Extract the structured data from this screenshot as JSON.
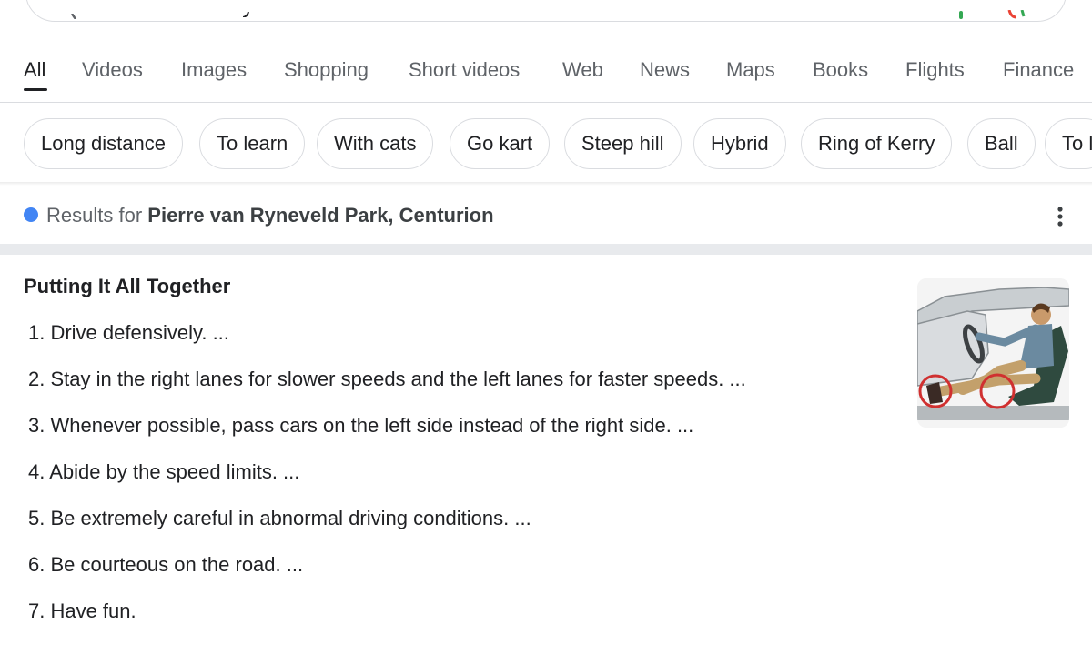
{
  "search": {
    "icon": "search-icon",
    "mic_icon": "mic-icon",
    "lens_icon": "lens-icon"
  },
  "tabs": [
    {
      "label": "All",
      "active": true
    },
    {
      "label": "Videos"
    },
    {
      "label": "Images"
    },
    {
      "label": "Shopping"
    },
    {
      "label": "Short videos"
    },
    {
      "label": "Web"
    },
    {
      "label": "News"
    },
    {
      "label": "Maps"
    },
    {
      "label": "Books"
    },
    {
      "label": "Flights"
    },
    {
      "label": "Finance"
    }
  ],
  "chips": [
    "Long distance",
    "To learn",
    "With cats",
    "Go kart",
    "Steep hill",
    "Hybrid",
    "Ring of Kerry",
    "Ball",
    "To l"
  ],
  "location": {
    "prefix": "Results for",
    "place": "Pierre van Ryneveld Park, Centurion",
    "dot_color": "#4285f4"
  },
  "snippet": {
    "title": "Putting It All Together",
    "items": [
      "1. Drive defensively. ...",
      "2. Stay in the right lanes for slower speeds and the left lanes for faster speeds. ...",
      "3. Whenever possible, pass cars on the left side instead of the right side. ...",
      "4. Abide by the speed limits. ...",
      "5. Be extremely careful in abnormal driving conditions. ...",
      "6. Be courteous on the road. ...",
      "7. Have fun."
    ]
  }
}
